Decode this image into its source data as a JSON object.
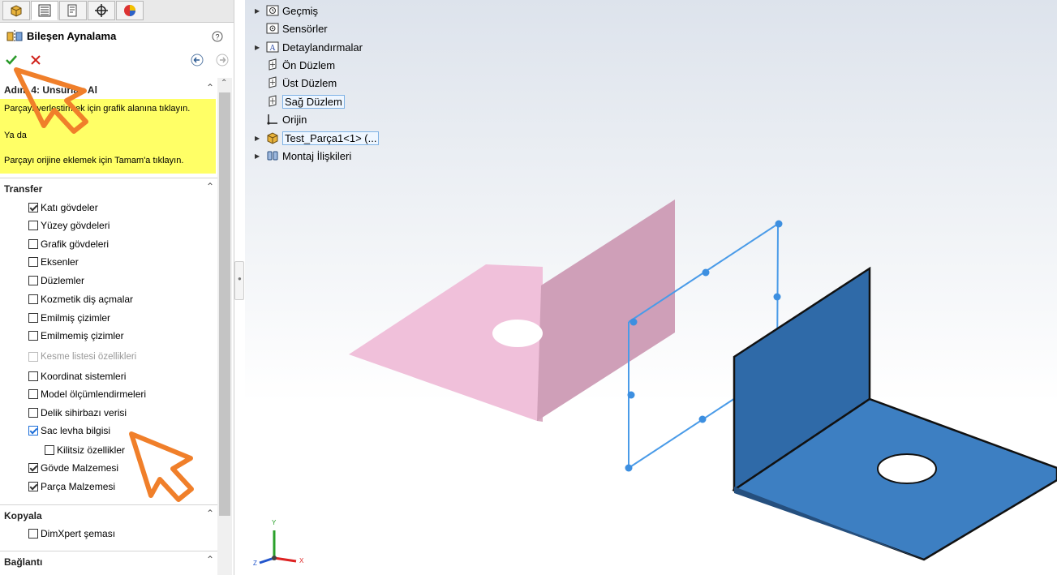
{
  "panel": {
    "tabs": [
      "feature-manager-icon",
      "property-manager-icon",
      "configuration-manager-icon",
      "dimxpert-icon",
      "display-manager-icon"
    ],
    "title": "Bileşen Aynalama",
    "help_icon": "help-icon",
    "ok_icon": "checkmark-icon",
    "cancel_icon": "x-icon",
    "step": {
      "title": "Adım 4: Unsurları Al",
      "message_lines": [
        "Parçayı yerleştirmek için grafik alanına tıklayın.",
        "Ya da",
        "Parçayı orijine eklemek için Tamam'a tıklayın."
      ]
    },
    "transfer": {
      "title": "Transfer",
      "items": [
        {
          "label": "Katı gövdeler",
          "checked": true
        },
        {
          "label": "Yüzey gövdeleri",
          "checked": false
        },
        {
          "label": "Grafik gövdeleri",
          "checked": false
        },
        {
          "label": "Eksenler",
          "checked": false
        },
        {
          "label": "Düzlemler",
          "checked": false
        },
        {
          "label": "Kozmetik diş açmalar",
          "checked": false
        },
        {
          "label": "Emilmiş çizimler",
          "checked": false
        },
        {
          "label": "Emilmemiş çizimler",
          "checked": false
        },
        {
          "label": "Kesme listesi özellikleri",
          "checked": false,
          "disabled": true
        },
        {
          "label": "Koordinat sistemleri",
          "checked": false
        },
        {
          "label": "Model ölçümlendirmeleri",
          "checked": false
        },
        {
          "label": "Delik sihirbazı verisi",
          "checked": false
        },
        {
          "label": "Sac levha bilgisi",
          "checked": true
        },
        {
          "label": "Kilitsiz özellikler",
          "checked": false
        },
        {
          "label": "Gövde Malzemesi",
          "checked": true
        },
        {
          "label": "Parça Malzemesi",
          "checked": true
        }
      ]
    },
    "kopyala": {
      "title": "Kopyala",
      "items": [
        {
          "label": "DimXpert şeması",
          "checked": false
        }
      ]
    },
    "baglanti": {
      "title": "Bağlantı"
    }
  },
  "tree": [
    {
      "label": "Geçmiş",
      "icon": "history-folder-icon",
      "expandable": true
    },
    {
      "label": "Sensörler",
      "icon": "sensors-icon",
      "expandable": false
    },
    {
      "label": "Detaylandırmalar",
      "icon": "annotations-icon",
      "expandable": true
    },
    {
      "label": "Ön Düzlem",
      "icon": "plane-icon",
      "expandable": false
    },
    {
      "label": "Üst Düzlem",
      "icon": "plane-icon",
      "expandable": false
    },
    {
      "label": "Sağ Düzlem",
      "icon": "plane-icon",
      "expandable": false,
      "selected": true
    },
    {
      "label": "Orijin",
      "icon": "origin-icon",
      "expandable": false
    },
    {
      "label": "Test_Parça1<1> (...",
      "icon": "part-icon",
      "expandable": true,
      "selected": true
    },
    {
      "label": "Montaj İlişkileri",
      "icon": "mates-icon",
      "expandable": true
    }
  ],
  "triad": {
    "x": "X",
    "y": "Y",
    "z": "Z"
  },
  "colors": {
    "message_bg": "#ffff66",
    "pink_part": "#e6b8cf",
    "blue_part": "#3e7dc0",
    "plane_preview": "#4a9be8",
    "annotation_arrow": "#f07f2a"
  }
}
